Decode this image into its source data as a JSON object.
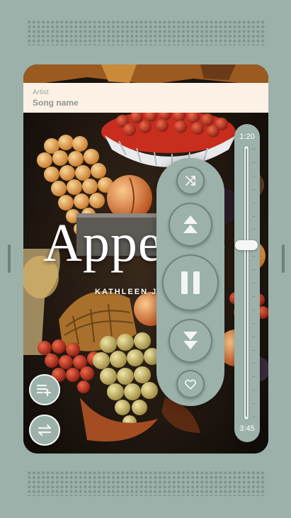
{
  "track": {
    "artist": "Artist",
    "song": "Song name"
  },
  "album_cover": {
    "title_fragment": "Appe",
    "title_tail": "e",
    "artist_fragment": "KATHLEEN J"
  },
  "seek": {
    "current_time": "1:20",
    "total_time": "3:45",
    "progress": 0.36
  },
  "controls": {
    "shuffle": "shuffle-icon",
    "previous": "skip-previous-icon",
    "play_pause": "pause-icon",
    "next": "skip-next-icon",
    "favorite": "heart-outline-icon"
  },
  "side_buttons": {
    "queue": "playlist-add-icon",
    "swap": "swap-horizontal-icon"
  },
  "colors": {
    "shell": "#9bb1aa",
    "grille": "#7f948d",
    "info_bar": "#fdf1e6",
    "icon_dark": "#6f827c",
    "icon_light": "#f2f5f4"
  }
}
